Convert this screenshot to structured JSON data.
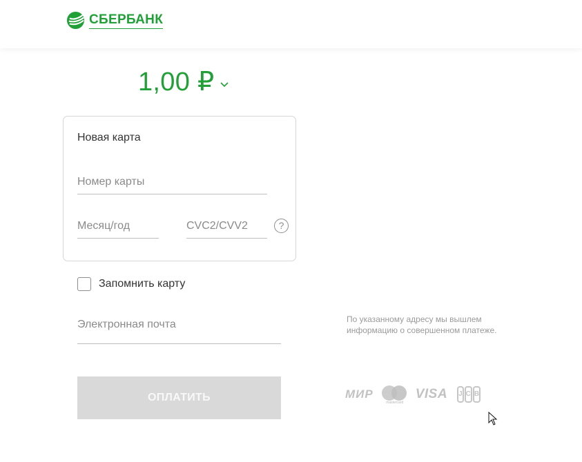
{
  "header": {
    "logo_text": "СБЕРБАНК",
    "brand_color": "#21a038"
  },
  "payment": {
    "amount": "1,00 ₽",
    "currency_toggle_icon": "chevron-down-icon"
  },
  "card_form": {
    "title": "Новая карта",
    "card_number_placeholder": "Номер карты",
    "expiry_placeholder": "Месяц/год",
    "cvc_placeholder": "CVC2/CVV2",
    "help_icon": "question-circle-icon",
    "help_symbol": "?"
  },
  "remember_card": {
    "label": "Запомнить карту",
    "checked": false
  },
  "email": {
    "placeholder": "Электронная почта",
    "note": "По указанному адресу мы вышлем информацию о совершенном платеже."
  },
  "pay_button": {
    "label": "ОПЛАТИТЬ",
    "disabled_color": "#d9d9d9"
  },
  "payment_systems": {
    "mir": "МИР",
    "mastercard_caption": "mastercard",
    "visa": "VISA",
    "jcb": [
      "J",
      "C",
      "B"
    ]
  }
}
